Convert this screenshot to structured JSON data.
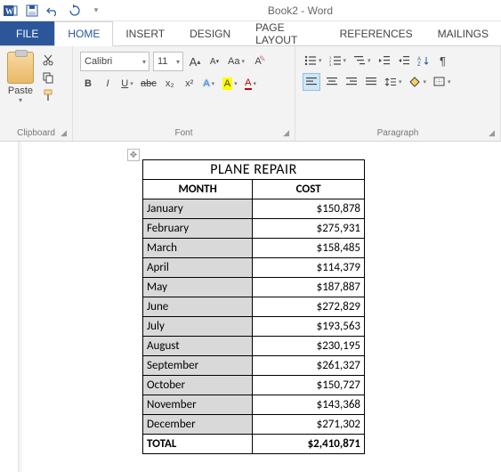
{
  "title": "Book2 - Word",
  "tabs": {
    "file": "FILE",
    "home": "HOME",
    "insert": "INSERT",
    "design": "DESIGN",
    "page_layout": "PAGE LAYOUT",
    "references": "REFERENCES",
    "mailings": "MAILINGS"
  },
  "ribbon": {
    "clipboard": {
      "label": "Clipboard",
      "paste": "Paste"
    },
    "font": {
      "label": "Font",
      "family": "Calibri",
      "size": "11",
      "grow": "A",
      "shrink": "A",
      "case": "Aa",
      "bold": "B",
      "italic": "I",
      "underline": "U",
      "strike": "abc",
      "sub": "x₂",
      "sup": "x²",
      "effects": "A",
      "highlight": "A",
      "color": "A"
    },
    "paragraph": {
      "label": "Paragraph"
    }
  },
  "chart_data": {
    "type": "table",
    "title": "PLANE REPAIR",
    "headers": [
      "MONTH",
      "COST"
    ],
    "rows": [
      {
        "month": "January",
        "cost": "$150,878"
      },
      {
        "month": "February",
        "cost": "$275,931"
      },
      {
        "month": "March",
        "cost": "$158,485"
      },
      {
        "month": "April",
        "cost": "$114,379"
      },
      {
        "month": "May",
        "cost": "$187,887"
      },
      {
        "month": "June",
        "cost": "$272,829"
      },
      {
        "month": "July",
        "cost": "$193,563"
      },
      {
        "month": "August",
        "cost": "$230,195"
      },
      {
        "month": "September",
        "cost": "$261,327"
      },
      {
        "month": "October",
        "cost": "$150,727"
      },
      {
        "month": "November",
        "cost": "$143,368"
      },
      {
        "month": "December",
        "cost": "$271,302"
      }
    ],
    "total": {
      "label": "TOTAL",
      "cost": "$2,410,871"
    }
  }
}
